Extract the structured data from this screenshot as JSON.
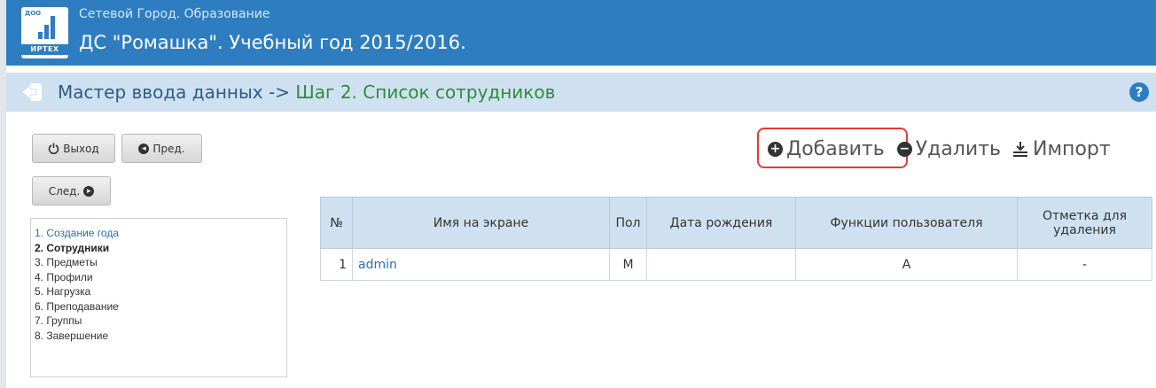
{
  "header": {
    "logo_badge": "ДОО",
    "logo_brand": "ИРТЕХ",
    "app_title": "Сетевой Город. Образование",
    "org_title": "ДС \"Ромашка\". Учебный год 2015/2016."
  },
  "wizard": {
    "title_prefix": "Мастер ввода данных -> ",
    "title_step": "Шаг 2. Список сотрудников",
    "help_label": "?"
  },
  "nav_buttons": {
    "exit_label": "Выход",
    "prev_label": "Пред.",
    "next_label": "След."
  },
  "steps": [
    {
      "label": "1. Создание года",
      "state": "link"
    },
    {
      "label": "2. Сотрудники",
      "state": "current"
    },
    {
      "label": "3. Предметы",
      "state": "normal"
    },
    {
      "label": "4. Профили",
      "state": "normal"
    },
    {
      "label": "5. Нагрузка",
      "state": "normal"
    },
    {
      "label": "6. Преподавание",
      "state": "normal"
    },
    {
      "label": "7. Группы",
      "state": "normal"
    },
    {
      "label": "8. Завершение",
      "state": "normal"
    }
  ],
  "actions": {
    "add_label": "Добавить",
    "delete_label": "Удалить",
    "import_label": "Импорт"
  },
  "table": {
    "headers": [
      "№",
      "Имя на экране",
      "Пол",
      "Дата рождения",
      "Функции пользователя",
      "Отметка для удаления"
    ],
    "rows": [
      {
        "num": "1",
        "name": "admin",
        "gender": "М",
        "birth_date": "",
        "functions": "А",
        "delete_mark": "-"
      }
    ]
  },
  "colors": {
    "header_bg": "#2e7dc0",
    "subbar_bg": "#cfe1f1",
    "highlight": "#e53935",
    "step_green": "#2f8a3d",
    "link_blue": "#2a6fad"
  }
}
